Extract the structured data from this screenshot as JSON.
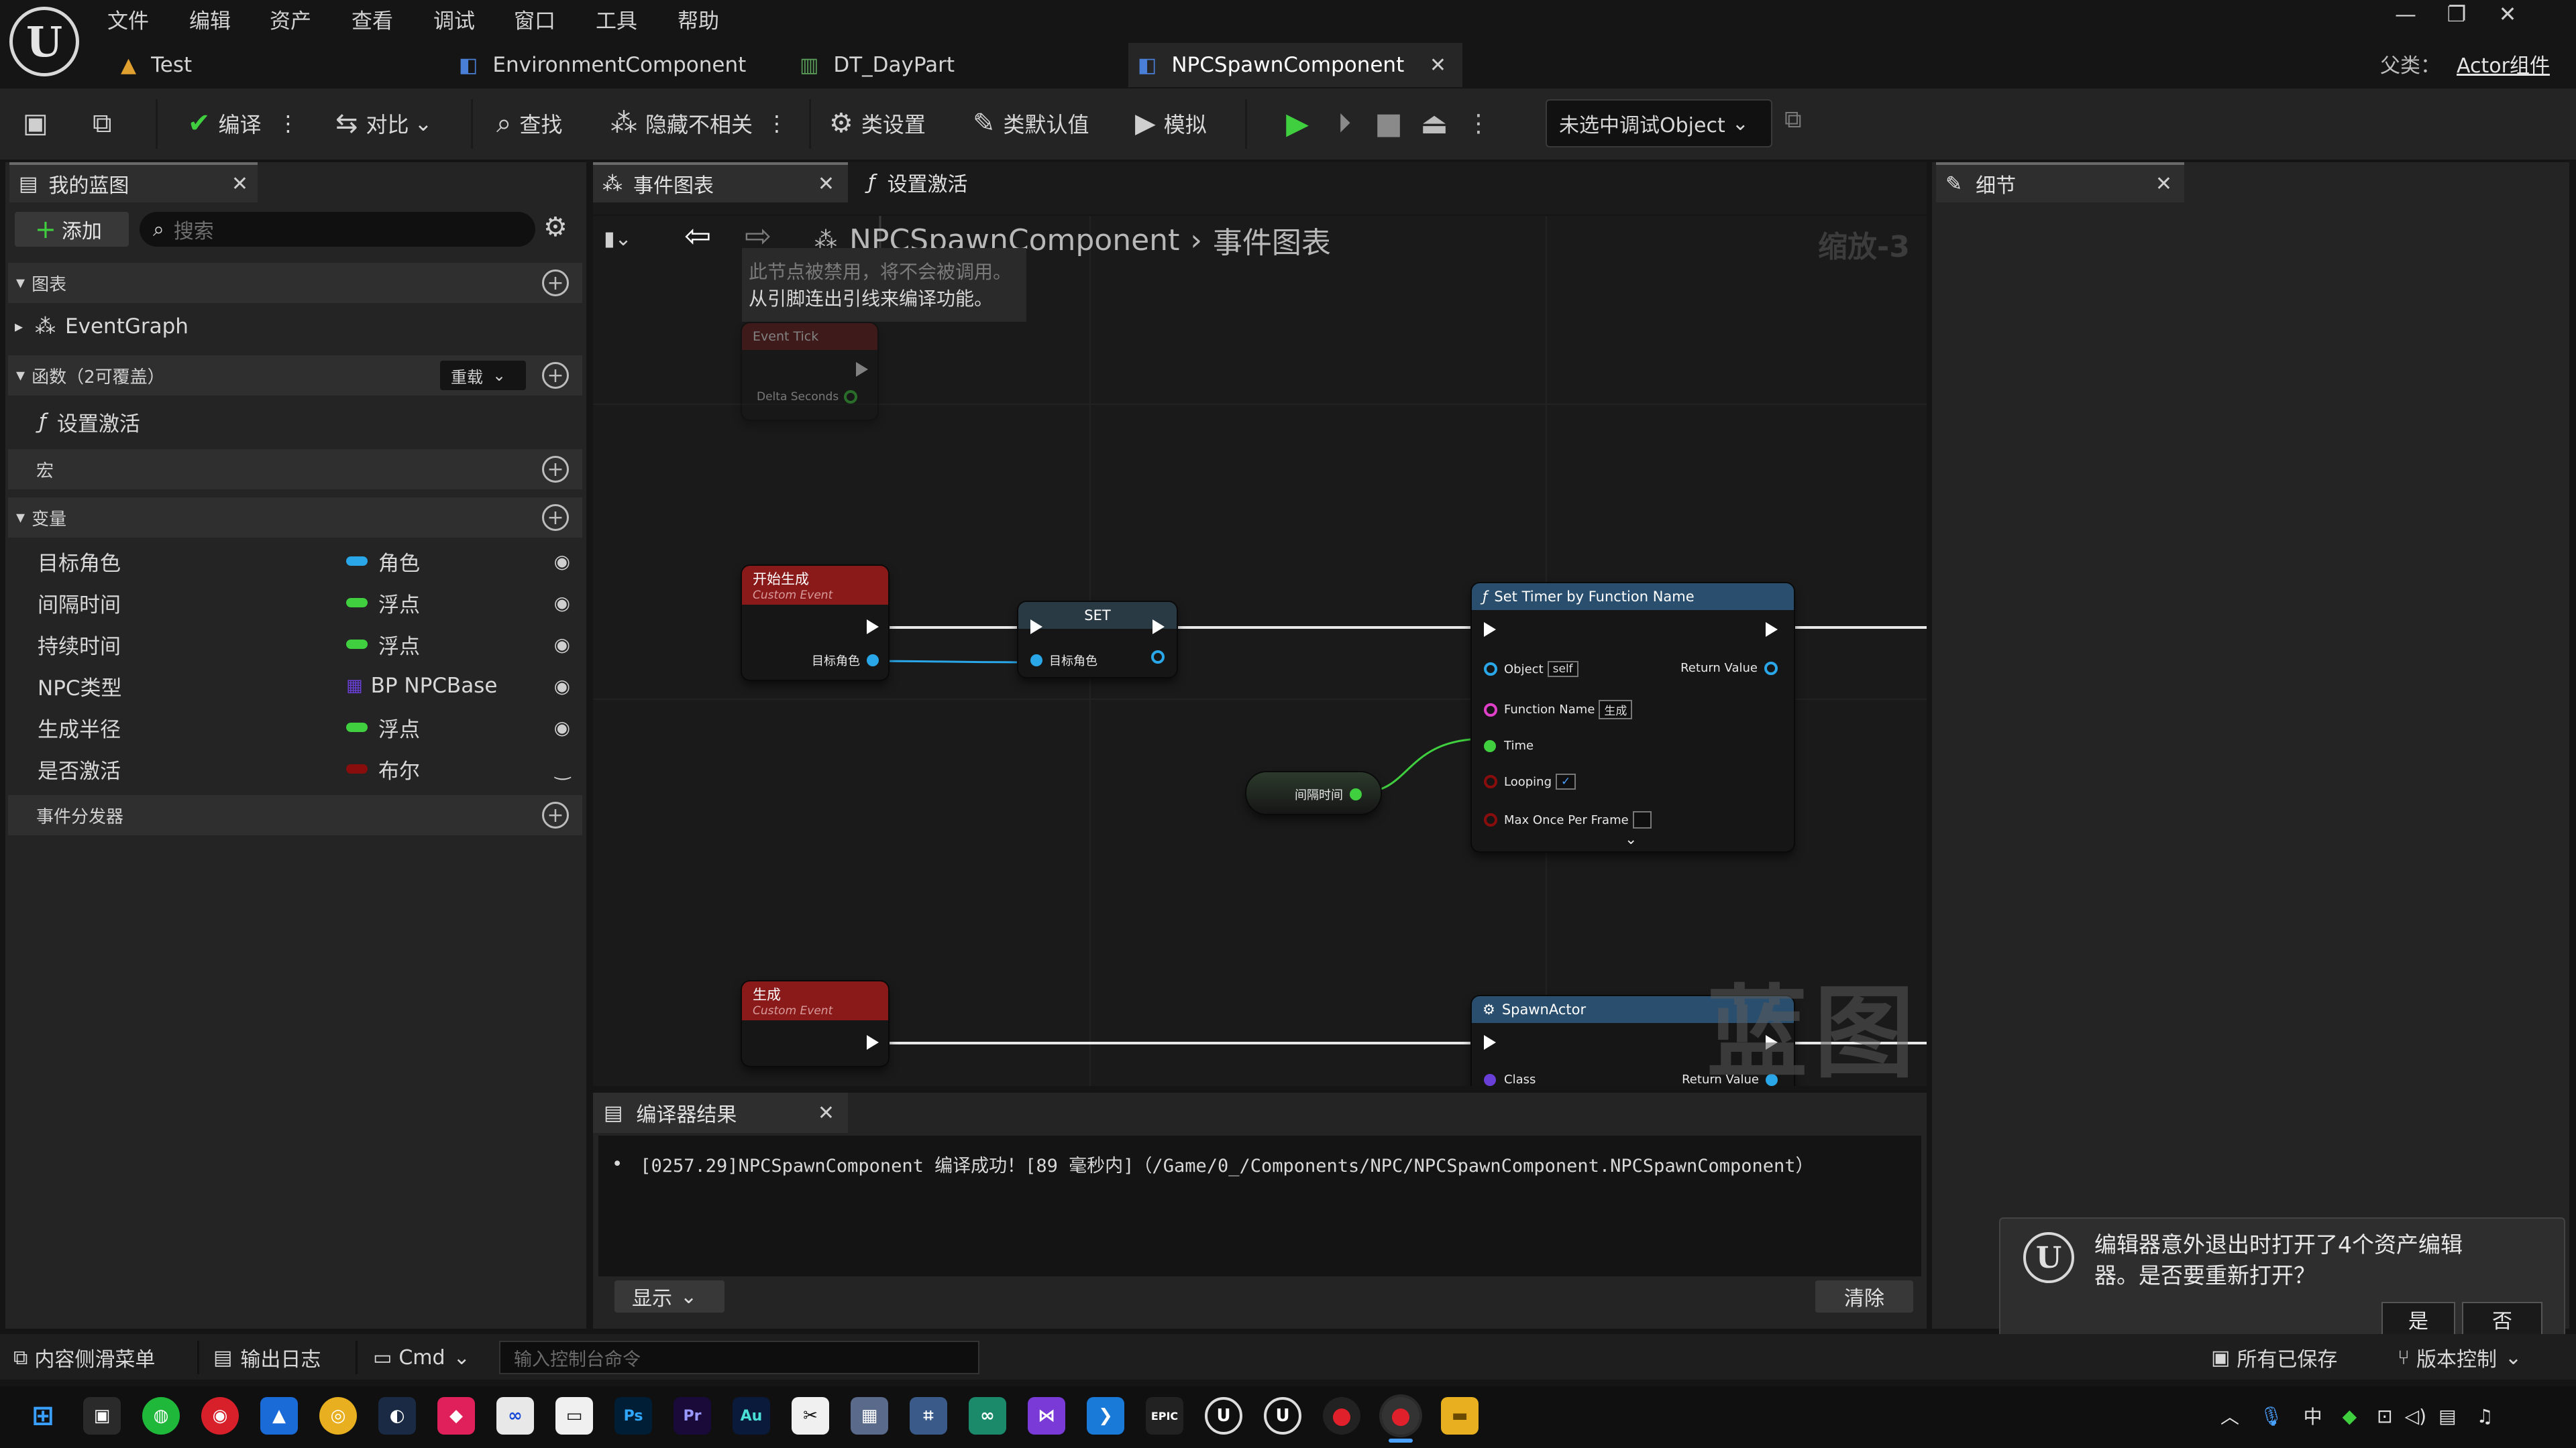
{
  "menu": [
    "文件",
    "编辑",
    "资产",
    "查看",
    "调试",
    "窗口",
    "工具",
    "帮助"
  ],
  "doc_tabs": [
    "Test",
    "EnvironmentComponent",
    "DT_DayPart",
    "NPCSpawnComponent"
  ],
  "parent_class": {
    "label": "父类：",
    "value": "Actor组件"
  },
  "toolbar": {
    "compile": "编译",
    "diff": "对比",
    "find": "查找",
    "hide_unrelated": "隐藏不相关",
    "class_settings": "类设置",
    "class_defaults": "类默认值",
    "simulate": "模拟",
    "debug_object": "未选中调试Object"
  },
  "my_blueprint": {
    "tab": "我的蓝图",
    "add": "添加",
    "search_placeholder": "搜索",
    "graphs_header": "图表",
    "event_graph": "EventGraph",
    "functions_header": "函数（2可覆盖）",
    "override": "重载",
    "function_item": "设置激活",
    "macros_header": "宏",
    "variables_header": "变量",
    "variables": [
      {
        "name": "目标角色",
        "type": "角色",
        "color": "#2aa7e8"
      },
      {
        "name": "间隔时间",
        "type": "浮点",
        "color": "#3fcf3f"
      },
      {
        "name": "持续时间",
        "type": "浮点",
        "color": "#3fcf3f"
      },
      {
        "name": "NPC类型",
        "type": "BP NPCBase",
        "color": "#6a3fd8"
      },
      {
        "name": "生成半径",
        "type": "浮点",
        "color": "#3fcf3f"
      },
      {
        "name": "是否激活",
        "type": "布尔",
        "color": "#8a0d0d"
      }
    ],
    "dispatchers_header": "事件分发器"
  },
  "graph_tabs": [
    "事件图表",
    "设置激活"
  ],
  "breadcrumb": {
    "component": "NPCSpawnComponent",
    "graph": "事件图表"
  },
  "zoom": "缩放-3",
  "disabled_tooltip": {
    "line1": "此节点被禁用，将不会被调用。",
    "line2": "从引脚连出引线来编译功能。"
  },
  "nodes": {
    "event_tick": {
      "title": "Event Tick",
      "pin": "Delta Seconds"
    },
    "start_spawn": {
      "title": "开始生成",
      "subtitle": "Custom Event",
      "pin": "目标角色"
    },
    "set": {
      "title": "SET",
      "pin": "目标角色"
    },
    "interval_var": "间隔时间",
    "set_timer": {
      "title": "Set Timer by Function Name",
      "object": "Object",
      "object_val": "self",
      "return": "Return Value",
      "function_name": "Function Name",
      "function_val": "生成",
      "time": "Time",
      "looping": "Looping",
      "max_once": "Max Once Per Frame"
    },
    "spawn": {
      "title": "生成",
      "subtitle": "Custom Event"
    },
    "spawn_actor": {
      "title": "SpawnActor",
      "class": "Class",
      "return": "Return Value"
    }
  },
  "watermark": "蓝图",
  "compiler": {
    "tab": "编译器结果",
    "message": "[0257.29]NPCSpawnComponent 编译成功！[89 毫秒内]（/Game/0_/Components/NPC/NPCSpawnComponent.NPCSpawnComponent）",
    "show": "显示",
    "clear": "清除"
  },
  "details": {
    "tab": "细节"
  },
  "notification": {
    "text_line1": "编辑器意外退出时打开了4个资产编辑",
    "text_line2": "器。是否要重新打开？",
    "yes": "是",
    "no": "否"
  },
  "statusbar": {
    "content_drawer": "内容侧滑菜单",
    "output_log": "输出日志",
    "cmd": "Cmd",
    "console_placeholder": "输入控制台命令",
    "all_saved": "所有已保存",
    "source_control": "版本控制"
  },
  "tray": {
    "ime": "中"
  }
}
